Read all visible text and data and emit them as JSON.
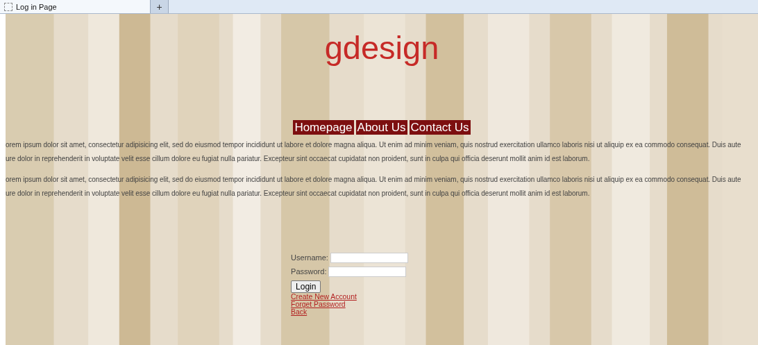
{
  "browser_tab": {
    "title": "Log in Page",
    "new_tab": "+"
  },
  "logo": "gdesign",
  "nav": [
    {
      "label": "Homepage"
    },
    {
      "label": "About Us"
    },
    {
      "label": "Contact Us"
    }
  ],
  "paragraphs": [
    [
      "orem ipsum dolor sit amet, consectetur adipisicing elit, sed do eiusmod tempor incididunt ut labore et dolore magna aliqua. Ut enim ad minim veniam, quis nostrud exercitation ullamco laboris nisi ut aliquip ex ea commodo consequat. Duis aute",
      "ure dolor in reprehenderit in voluptate velit esse cillum dolore eu fugiat nulla pariatur. Excepteur sint occaecat cupidatat non proident, sunt in culpa qui officia deserunt mollit anim id est laborum."
    ],
    [
      "orem ipsum dolor sit amet, consectetur adipisicing elit, sed do eiusmod tempor incididunt ut labore et dolore magna aliqua. Ut enim ad minim veniam, quis nostrud exercitation ullamco laboris nisi ut aliquip ex ea commodo consequat. Duis aute",
      "ure dolor in reprehenderit in voluptate velit esse cillum dolore eu fugiat nulla pariatur. Excepteur sint occaecat cupidatat non proident, sunt in culpa qui officia deserunt mollit anim id est laborum."
    ]
  ],
  "form": {
    "fields": [
      {
        "label": "Username:"
      },
      {
        "label": "Password:"
      }
    ],
    "button": "Login",
    "links": [
      "Create New Account",
      "Forget Password",
      "Back"
    ]
  }
}
